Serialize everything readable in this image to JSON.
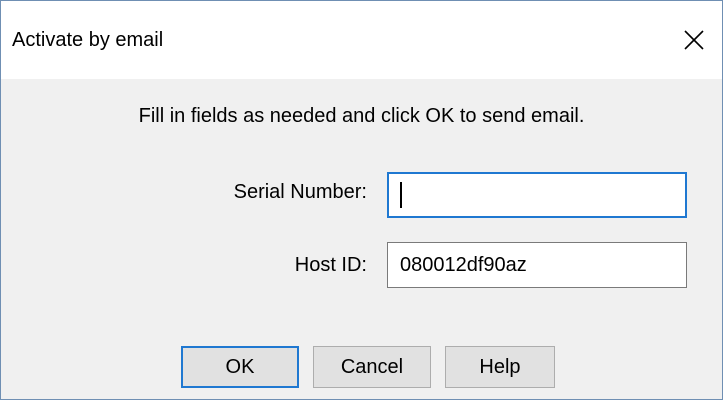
{
  "window": {
    "title": "Activate by email",
    "close_icon": "close-icon"
  },
  "dialog": {
    "instruction": "Fill in fields as needed and click OK to send email.",
    "serial_number": {
      "label": "Serial Number:",
      "value": ""
    },
    "host_id": {
      "label": "Host ID:",
      "value": "080012df90az"
    }
  },
  "buttons": {
    "ok_label": "OK",
    "cancel_label": "Cancel",
    "help_label": "Help"
  },
  "colors": {
    "focus_accent": "#1f78d1",
    "client_background": "#f0f0f0",
    "button_face": "#e1e1e1"
  }
}
